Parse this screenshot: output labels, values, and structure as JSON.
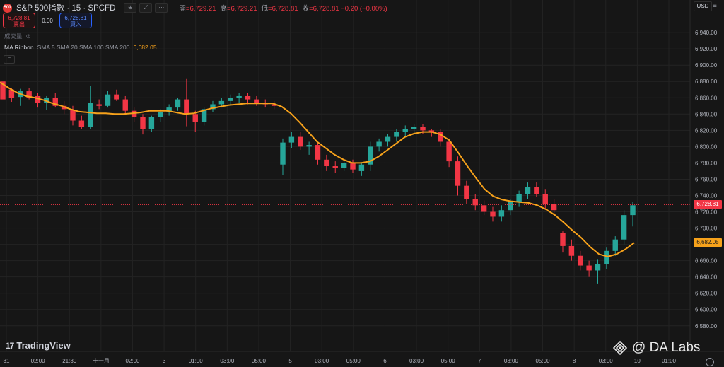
{
  "header": {
    "symbol_logo_text": "500",
    "symbol_title": "S&P 500指數 · 15 · SPCFD",
    "ohlc": [
      {
        "label": "開",
        "value": "=6,729.21"
      },
      {
        "label": "高",
        "value": "=6,729.21"
      },
      {
        "label": "低",
        "value": "=6,728.81"
      },
      {
        "label": "收",
        "value": "=6,728.81 −0.20 (−0.00%)"
      }
    ],
    "icons": [
      "compare-icon",
      "expand-icon",
      "more-icon"
    ]
  },
  "trade": {
    "sell_price": "6,728.81",
    "sell_label": "賣出",
    "spread": "0.00",
    "buy_price": "6,728.81",
    "buy_label": "買入"
  },
  "volume_label": "成交量",
  "indicator": {
    "name": "MA Ribbon",
    "params": "SMA 5 SMA 20 SMA 100 SMA 200",
    "value": "6,682.05"
  },
  "currency": "USD",
  "last_price_badge": "6,728.81",
  "ma_badge": "6,682.05",
  "branding": {
    "tv_mark": "17",
    "tv_name": "TradingView",
    "watermark": "@ DA  Labs"
  },
  "colors": {
    "background": "#161616",
    "up": "#26a69a",
    "down": "#f23645",
    "ma": "#f7a21b",
    "grid": "#232323",
    "axis_text": "#b2b5be"
  },
  "chart_data": {
    "type": "candlestick",
    "title": "S&P 500指數 · 15 · SPCFD",
    "ylim": [
      6572,
      6954
    ],
    "y_ticks": [
      6580,
      6600,
      6620,
      6640,
      6660,
      6680,
      6700,
      6720,
      6740,
      6760,
      6780,
      6800,
      6820,
      6840,
      6860,
      6880,
      6900,
      6920,
      6940
    ],
    "y_tick_labels": [
      "6,580.00",
      "6,600.00",
      "6,620.00",
      "6,640.00",
      "6,660.00",
      "6,680.00",
      "6,700.00",
      "6,720.00",
      "6,740.00",
      "6,760.00",
      "6,780.00",
      "6,800.00",
      "6,820.00",
      "6,840.00",
      "6,860.00",
      "6,880.00",
      "6,900.00",
      "6,920.00",
      "6,940.00"
    ],
    "x_tick_labels": [
      "31",
      "02:00",
      "21:30",
      "十一月",
      "02:00",
      "3",
      "01:00",
      "03:00",
      "05:00",
      "5",
      "03:00",
      "05:00",
      "6",
      "03:00",
      "05:00",
      "7",
      "03:00",
      "05:00",
      "8",
      "03:00",
      "10",
      "01:00"
    ],
    "last_price": 6728.81,
    "ma_last": 6682.05,
    "ma_series": {
      "name": "MA Ribbon",
      "values": [
        6879,
        6872,
        6866,
        6862,
        6860,
        6857,
        6853,
        6850,
        6846,
        6843,
        6842,
        6841,
        6841,
        6840,
        6840,
        6841,
        6842,
        6844,
        6844,
        6844,
        6842,
        6840,
        6841,
        6844,
        6847,
        6849,
        6851,
        6852,
        6853,
        6853,
        6853,
        6853,
        6849,
        6841,
        6830,
        6818,
        6806,
        6798,
        6790,
        6784,
        6780,
        6780,
        6782,
        6788,
        6796,
        6804,
        6812,
        6816,
        6818,
        6818,
        6815,
        6808,
        6793,
        6777,
        6762,
        6748,
        6739,
        6735,
        6733,
        6732,
        6731,
        6728,
        6723,
        6716,
        6707,
        6697,
        6688,
        6677,
        6668,
        6665,
        6668,
        6674,
        6682
      ]
    },
    "candles": [
      [
        6880,
        6872,
        6864,
        6858
      ],
      [
        6870,
        6872,
        6855,
        6860
      ],
      [
        6861,
        6871,
        6850,
        6868
      ],
      [
        6868,
        6872,
        6858,
        6860
      ],
      [
        6862,
        6866,
        6848,
        6854
      ],
      [
        6854,
        6862,
        6845,
        6860
      ],
      [
        6860,
        6866,
        6848,
        6850
      ],
      [
        6850,
        6856,
        6840,
        6846
      ],
      [
        6845,
        6850,
        6826,
        6832
      ],
      [
        6832,
        6838,
        6822,
        6824
      ],
      [
        6824,
        6875,
        6822,
        6854
      ],
      [
        6852,
        6858,
        6846,
        6850
      ],
      [
        6850,
        6868,
        6848,
        6864
      ],
      [
        6864,
        6870,
        6856,
        6858
      ],
      [
        6858,
        6862,
        6840,
        6844
      ],
      [
        6844,
        6848,
        6830,
        6836
      ],
      [
        6836,
        6840,
        6815,
        6822
      ],
      [
        6822,
        6838,
        6818,
        6836
      ],
      [
        6836,
        6846,
        6830,
        6842
      ],
      [
        6842,
        6852,
        6838,
        6848
      ],
      [
        6848,
        6860,
        6844,
        6858
      ],
      [
        6858,
        6883,
        6825,
        6840
      ],
      [
        6840,
        6844,
        6818,
        6830
      ],
      [
        6830,
        6848,
        6826,
        6846
      ],
      [
        6846,
        6856,
        6842,
        6852
      ],
      [
        6852,
        6860,
        6848,
        6856
      ],
      [
        6856,
        6864,
        6850,
        6860
      ],
      [
        6860,
        6866,
        6854,
        6862
      ],
      [
        6862,
        6866,
        6852,
        6858
      ],
      [
        6858,
        6862,
        6850,
        6854
      ],
      [
        6854,
        6858,
        6848,
        6852
      ],
      [
        6852,
        6856,
        6846,
        6850
      ],
      [
        6778,
        6810,
        6765,
        6805
      ],
      [
        6805,
        6818,
        6798,
        6812
      ],
      [
        6812,
        6818,
        6796,
        6800
      ],
      [
        6800,
        6806,
        6790,
        6802
      ],
      [
        6802,
        6806,
        6778,
        6784
      ],
      [
        6784,
        6790,
        6770,
        6776
      ],
      [
        6776,
        6782,
        6768,
        6774
      ],
      [
        6774,
        6782,
        6770,
        6780
      ],
      [
        6780,
        6784,
        6768,
        6772
      ],
      [
        6770,
        6780,
        6764,
        6778
      ],
      [
        6778,
        6806,
        6770,
        6800
      ],
      [
        6800,
        6810,
        6794,
        6806
      ],
      [
        6806,
        6816,
        6800,
        6812
      ],
      [
        6812,
        6822,
        6806,
        6818
      ],
      [
        6818,
        6826,
        6812,
        6822
      ],
      [
        6822,
        6828,
        6816,
        6824
      ],
      [
        6824,
        6828,
        6816,
        6820
      ],
      [
        6820,
        6822,
        6812,
        6818
      ],
      [
        6818,
        6822,
        6800,
        6806
      ],
      [
        6806,
        6810,
        6775,
        6782
      ],
      [
        6782,
        6788,
        6740,
        6752
      ],
      [
        6752,
        6758,
        6730,
        6736
      ],
      [
        6736,
        6742,
        6722,
        6728
      ],
      [
        6728,
        6734,
        6716,
        6720
      ],
      [
        6720,
        6726,
        6708,
        6714
      ],
      [
        6714,
        6728,
        6708,
        6722
      ],
      [
        6722,
        6736,
        6716,
        6732
      ],
      [
        6732,
        6746,
        6726,
        6742
      ],
      [
        6742,
        6756,
        6736,
        6750
      ],
      [
        6750,
        6756,
        6738,
        6742
      ],
      [
        6742,
        6748,
        6724,
        6730
      ],
      [
        6730,
        6736,
        6716,
        6722
      ],
      [
        6694,
        6696,
        6670,
        6678
      ],
      [
        6678,
        6686,
        6660,
        6666
      ],
      [
        6666,
        6672,
        6648,
        6654
      ],
      [
        6654,
        6660,
        6640,
        6648
      ],
      [
        6648,
        6662,
        6632,
        6656
      ],
      [
        6656,
        6676,
        6650,
        6672
      ],
      [
        6672,
        6690,
        6666,
        6686
      ],
      [
        6686,
        6722,
        6680,
        6716
      ],
      [
        6716,
        6732,
        6702,
        6728
      ]
    ]
  }
}
